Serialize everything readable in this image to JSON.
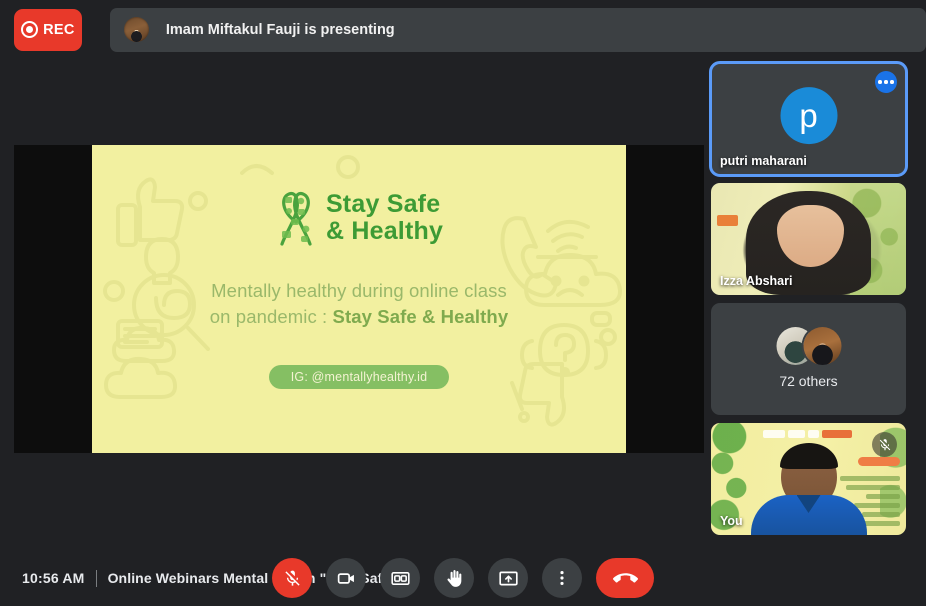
{
  "topbar": {
    "rec_label": "REC",
    "rec_icon": "record-circle-icon",
    "presenting_text": "Imam Miftakul Fauji is presenting",
    "presenter_avatar_alt": "Imam Miftakul Fauji"
  },
  "slide": {
    "logo_line1": "Stay  Safe",
    "logo_line2": "& Healthy",
    "logo_icon": "green-ribbon-doodle-icon",
    "subtitle_line1": "Mentally healthy during online class",
    "subtitle_line2_plain": "on pandemic : ",
    "subtitle_line2_strong": "Stay Safe & Healthy",
    "ig_handle": "IG: @mentallyhealthy.id",
    "background_color": "#f2f0a0",
    "accent_green": "#3d9b35",
    "pill_green": "#85bf63"
  },
  "sidebar": {
    "tiles": [
      {
        "name": "putri maharani",
        "type": "avatar",
        "avatar_letter": "p",
        "avatar_color": "#1a8bd8",
        "active": true,
        "has_more_button": true,
        "more_icon": "more-options-icon"
      },
      {
        "name": "Izza Abshari",
        "type": "video",
        "active": false
      },
      {
        "name": "72 others",
        "type": "others",
        "count_label": "72 others",
        "active": false
      },
      {
        "name": "You",
        "type": "video",
        "active": false,
        "muted": true,
        "mute_icon": "mic-muted-icon"
      }
    ]
  },
  "bottombar": {
    "time": "10:56 AM",
    "meeting_title": "Online Webinars Mental Health \"Stay Safe ...",
    "controls": [
      {
        "name": "microphone",
        "label": "Turn off microphone",
        "icon": "mic-muted-icon",
        "state": "muted",
        "color": "#e8392a"
      },
      {
        "name": "camera",
        "label": "Turn off camera",
        "icon": "video-camera-icon",
        "state": "on",
        "color": "#3c4043"
      },
      {
        "name": "captions",
        "label": "Turn on captions",
        "icon": "closed-caption-icon",
        "state": "off",
        "color": "#3c4043"
      },
      {
        "name": "raise-hand",
        "label": "Raise hand",
        "icon": "raised-hand-icon",
        "state": "off",
        "color": "#3c4043"
      },
      {
        "name": "present",
        "label": "Present now",
        "icon": "present-screen-icon",
        "state": "off",
        "color": "#3c4043"
      },
      {
        "name": "more-options",
        "label": "More options",
        "icon": "more-vertical-icon",
        "state": "off",
        "color": "#3c4043"
      },
      {
        "name": "hang-up",
        "label": "Leave call",
        "icon": "phone-hangup-icon",
        "state": "action",
        "color": "#e8392a"
      }
    ]
  },
  "theme": {
    "background": "#202124",
    "surface": "#3c4043",
    "active_border": "#5b9bf8",
    "red": "#e8392a"
  }
}
